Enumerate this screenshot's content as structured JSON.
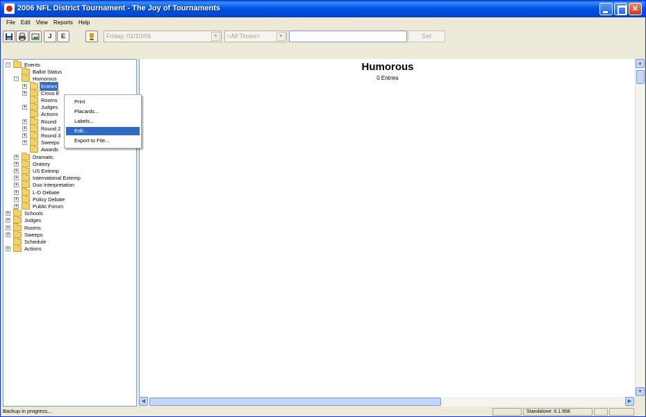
{
  "window": {
    "title": "2006 NFL District Tournament - The Joy of Tournaments"
  },
  "menu": [
    "File",
    "Edit",
    "View",
    "Reports",
    "Help"
  ],
  "toolbar": {
    "buttons": [
      {
        "name": "save-icon",
        "label": ""
      },
      {
        "name": "print-icon",
        "label": ""
      },
      {
        "name": "image-icon",
        "label": ""
      },
      {
        "name": "j-icon",
        "label": "J"
      },
      {
        "name": "e-icon",
        "label": "E"
      },
      {
        "name": "trophy-icon",
        "label": ""
      }
    ],
    "date_value": "Friday, 02/10/06",
    "time_value": "<All Times>",
    "search_value": "",
    "set_label": "Set"
  },
  "tree": [
    {
      "label": "Events",
      "level": 0,
      "expander": "-"
    },
    {
      "label": "Ballot Status",
      "level": 1,
      "expander": ""
    },
    {
      "label": "Humorous",
      "level": 1,
      "expander": "-"
    },
    {
      "label": "Entries",
      "level": 2,
      "expander": "+",
      "selected": true
    },
    {
      "label": "Cross E",
      "level": 2,
      "expander": "+"
    },
    {
      "label": "Rooms",
      "level": 2,
      "expander": ""
    },
    {
      "label": "Judges",
      "level": 2,
      "expander": "+"
    },
    {
      "label": "Actions",
      "level": 2,
      "expander": ""
    },
    {
      "label": "Round",
      "level": 2,
      "expander": "+"
    },
    {
      "label": "Round 2",
      "level": 2,
      "expander": "+"
    },
    {
      "label": "Round 3",
      "level": 2,
      "expander": "+"
    },
    {
      "label": "Sweeps",
      "level": 2,
      "expander": "+"
    },
    {
      "label": "Awards",
      "level": 2,
      "expander": ""
    },
    {
      "label": "Dramatic",
      "level": 1,
      "expander": "+"
    },
    {
      "label": "Oratory",
      "level": 1,
      "expander": "+"
    },
    {
      "label": "US Extemp",
      "level": 1,
      "expander": "+"
    },
    {
      "label": "International Extemp",
      "level": 1,
      "expander": "+"
    },
    {
      "label": "Duo Interpretation",
      "level": 1,
      "expander": "+"
    },
    {
      "label": "L-D Debate",
      "level": 1,
      "expander": "+"
    },
    {
      "label": "Policy Debate",
      "level": 1,
      "expander": "+"
    },
    {
      "label": "Public Forum",
      "level": 1,
      "expander": "+"
    },
    {
      "label": "Schools",
      "level": 0,
      "expander": "+"
    },
    {
      "label": "Judges",
      "level": 0,
      "expander": "+"
    },
    {
      "label": "Rooms",
      "level": 0,
      "expander": "+"
    },
    {
      "label": "Sweeps",
      "level": 0,
      "expander": "+"
    },
    {
      "label": "Schedule",
      "level": 0,
      "expander": ""
    },
    {
      "label": "Actions",
      "level": 0,
      "expander": "+"
    }
  ],
  "context_menu": [
    {
      "label": "Print",
      "highlighted": false
    },
    {
      "label": "Placards...",
      "highlighted": false
    },
    {
      "label": "Labels...",
      "highlighted": false
    },
    {
      "label": "Edit...",
      "highlighted": true
    },
    {
      "label": "Export to File...",
      "highlighted": false
    }
  ],
  "main": {
    "title": "Humorous",
    "subtitle": "0 Entries"
  },
  "status": {
    "left": "Backup in progress...",
    "version": "Standalone: 6.1.958"
  }
}
